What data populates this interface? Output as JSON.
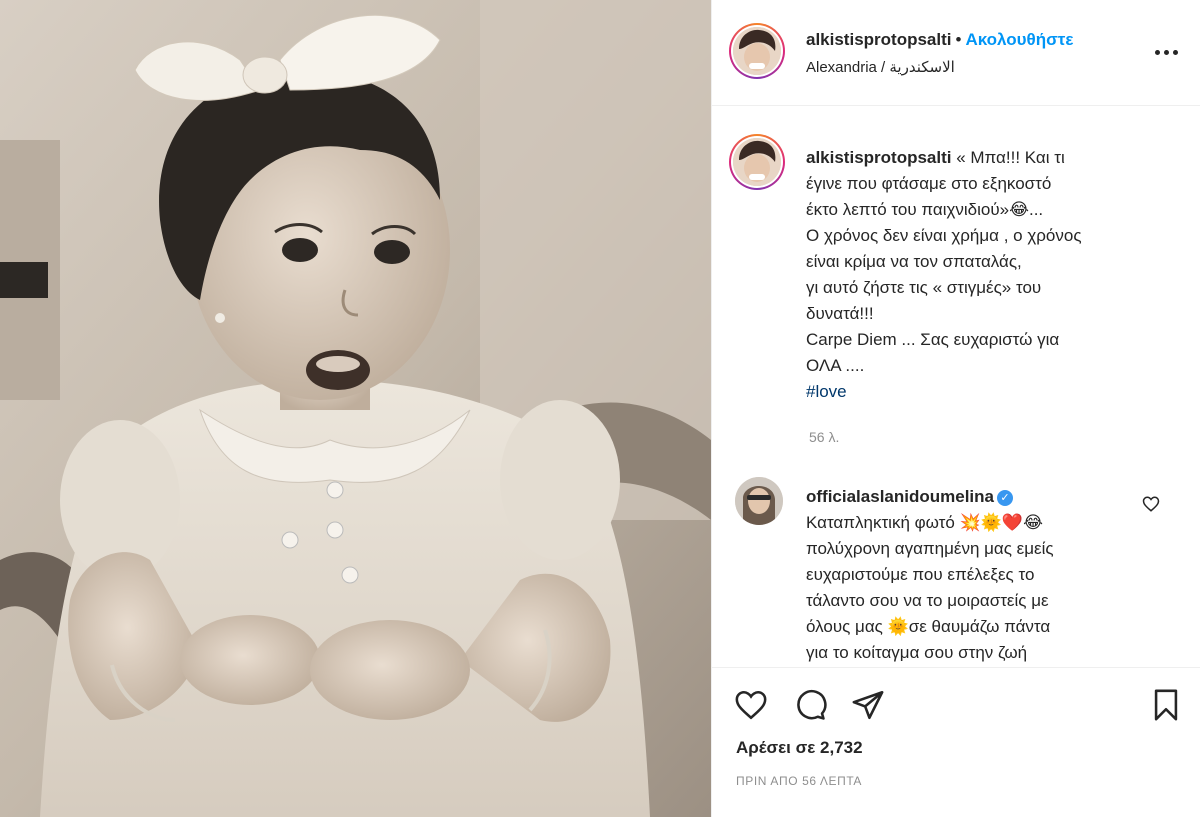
{
  "post": {
    "photo_alt": "",
    "header": {
      "username": "alkistisprotopsalti",
      "separator": "•",
      "follow_label": "Ακολουθήστε",
      "location": "Alexandria / الاسكندرية"
    },
    "caption": {
      "username": "alkistisprotopsalti",
      "lines": [
        "« Μπα!!! Και τι",
        "έγινε που φτάσαμε στο εξηκοστό",
        "έκτο λεπτό του παιχνιδιού»😂...",
        "Ο χρόνος δεν είναι χρήμα , ο χρόνος",
        "είναι κρίμα να τον σπαταλάς,",
        "γι αυτό ζήστε τις « στιγμές» του",
        "δυνατά!!!",
        "Carpe Diem ... Σας ευχαριστώ για",
        "ΟΛΑ ...."
      ],
      "hashtag": "#love",
      "time": "56 λ."
    },
    "comment": {
      "username": "officialaslanidoumelina",
      "verified_icon": "✓",
      "lines": [
        "Καταπληκτική φωτό 💥🌞❤️😂",
        "πολύχρονη αγαπημένη μας εμείς",
        "ευχαριστούμε που επέλεξες το",
        "τάλαντο σου να το μοιραστείς με",
        "όλους μας 🌞σε θαυμάζω πάντα",
        "για το κοίταγμα σου στην ζωή"
      ]
    },
    "actions": {
      "likes": "Αρέσει σε 2,732",
      "posted": "ΠΡΙΝ ΑΠΟ 56 ΛΕΠΤΑ"
    },
    "icons": {
      "more": "more-options-icon",
      "like": "heart-icon",
      "comment": "comment-icon",
      "share": "send-icon",
      "save": "bookmark-icon"
    },
    "colors": {
      "link_blue": "#0095f6",
      "hashtag": "#00376b",
      "muted": "#8e8e8e",
      "verified": "#3897f0"
    }
  }
}
